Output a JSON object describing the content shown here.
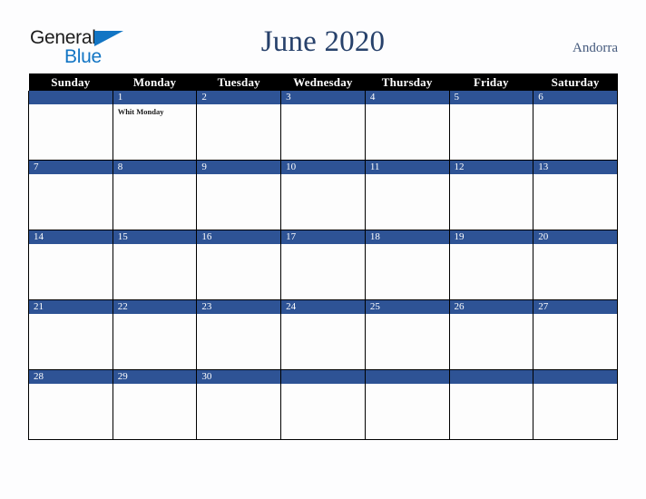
{
  "brand": {
    "name_part1": "General",
    "name_part2": "Blue",
    "triangle_icon": "blue-triangle-icon",
    "color_primary": "#1275c4",
    "color_text": "#1d1d1d"
  },
  "header": {
    "title": "June 2020",
    "country": "Andorra",
    "title_color": "#27416b",
    "country_color": "#44597c"
  },
  "calendar": {
    "weekday_headers": [
      "Sunday",
      "Monday",
      "Tuesday",
      "Wednesday",
      "Thursday",
      "Friday",
      "Saturday"
    ],
    "header_bg": "#000000",
    "header_fg": "#ffffff",
    "daynum_bg": "#2e5395",
    "daynum_fg": "#ffffff",
    "cell_bg": "#fdfdfd",
    "grid_color": "#000000",
    "weeks": [
      [
        {
          "day": "",
          "event": ""
        },
        {
          "day": "1",
          "event": "Whit Monday"
        },
        {
          "day": "2",
          "event": ""
        },
        {
          "day": "3",
          "event": ""
        },
        {
          "day": "4",
          "event": ""
        },
        {
          "day": "5",
          "event": ""
        },
        {
          "day": "6",
          "event": ""
        }
      ],
      [
        {
          "day": "7",
          "event": ""
        },
        {
          "day": "8",
          "event": ""
        },
        {
          "day": "9",
          "event": ""
        },
        {
          "day": "10",
          "event": ""
        },
        {
          "day": "11",
          "event": ""
        },
        {
          "day": "12",
          "event": ""
        },
        {
          "day": "13",
          "event": ""
        }
      ],
      [
        {
          "day": "14",
          "event": ""
        },
        {
          "day": "15",
          "event": ""
        },
        {
          "day": "16",
          "event": ""
        },
        {
          "day": "17",
          "event": ""
        },
        {
          "day": "18",
          "event": ""
        },
        {
          "day": "19",
          "event": ""
        },
        {
          "day": "20",
          "event": ""
        }
      ],
      [
        {
          "day": "21",
          "event": ""
        },
        {
          "day": "22",
          "event": ""
        },
        {
          "day": "23",
          "event": ""
        },
        {
          "day": "24",
          "event": ""
        },
        {
          "day": "25",
          "event": ""
        },
        {
          "day": "26",
          "event": ""
        },
        {
          "day": "27",
          "event": ""
        }
      ],
      [
        {
          "day": "28",
          "event": ""
        },
        {
          "day": "29",
          "event": ""
        },
        {
          "day": "30",
          "event": ""
        },
        {
          "day": "",
          "event": ""
        },
        {
          "day": "",
          "event": ""
        },
        {
          "day": "",
          "event": ""
        },
        {
          "day": "",
          "event": ""
        }
      ]
    ]
  }
}
